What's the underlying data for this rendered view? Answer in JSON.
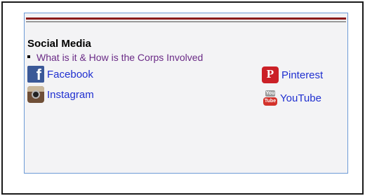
{
  "section": {
    "heading": "Social Media",
    "bullet_link": "What is it & How is the Corps Involved"
  },
  "social_links": {
    "facebook": {
      "label": "Facebook",
      "icon": "facebook-icon",
      "icon_glyph": "f"
    },
    "instagram": {
      "label": "Instagram",
      "icon": "instagram-icon"
    },
    "pinterest": {
      "label": "Pinterest",
      "icon": "pinterest-icon",
      "icon_glyph": "P"
    },
    "youtube": {
      "label": "YouTube",
      "icon": "youtube-icon",
      "icon_text_top": "You",
      "icon_text_bottom": "Tube"
    }
  },
  "colors": {
    "accent_rule": "#8b1a1a",
    "link_blue": "#1f2fd0",
    "visited_purple": "#6a2a86",
    "panel_border": "#6d9ad6"
  }
}
